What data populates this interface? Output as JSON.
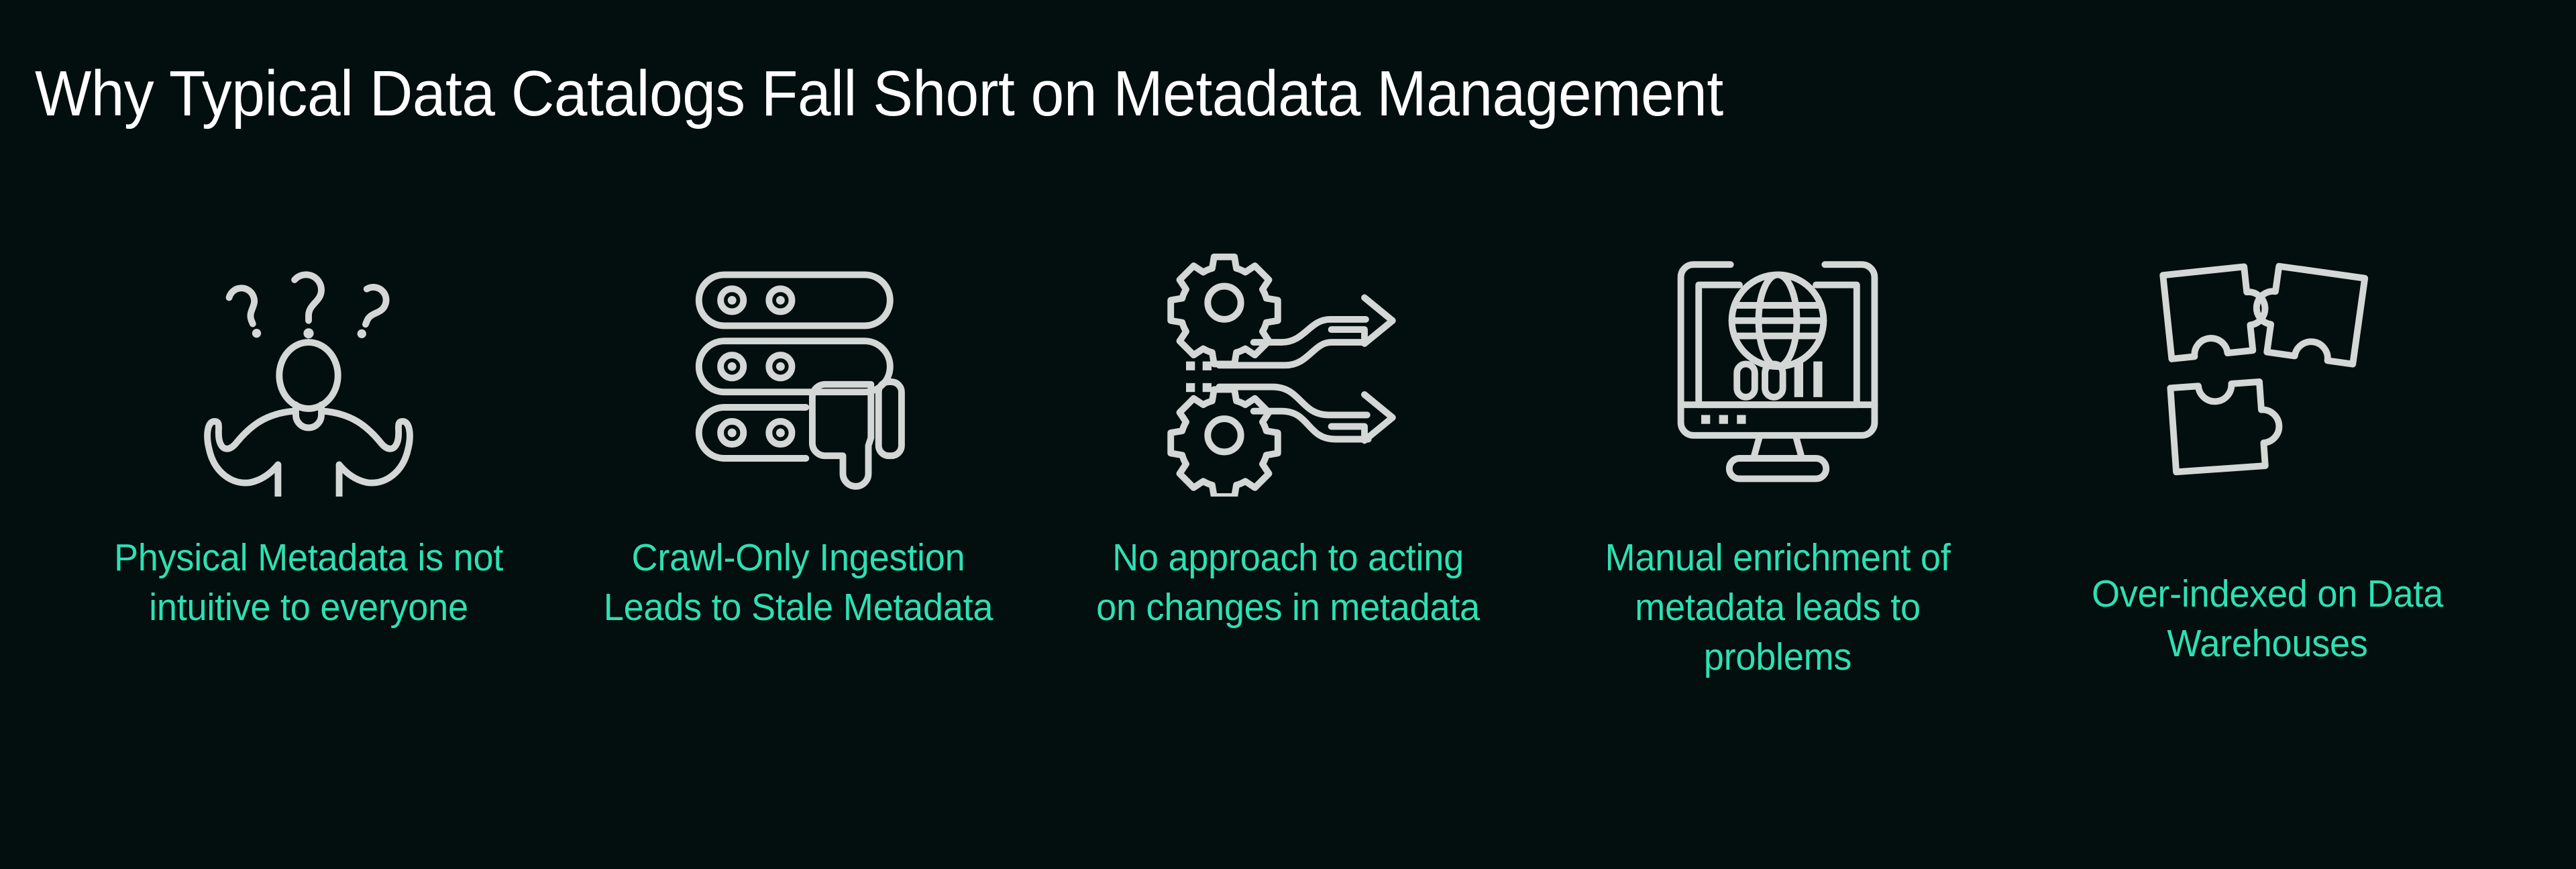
{
  "slide": {
    "title": "Why Typical Data Catalogs Fall Short on Metadata Management",
    "background_color": "#030e0e",
    "title_color": "#ffffff",
    "caption_color": "#2ee0b3",
    "icon_color": "#d3d7d5"
  },
  "columns": [
    {
      "icon": "confused-person-question-marks-icon",
      "caption": "Physical Metadata is not intuitive to everyone"
    },
    {
      "icon": "server-stack-thumbs-down-icon",
      "caption": "Crawl-Only Ingestion Leads to Stale Metadata"
    },
    {
      "icon": "gears-crossing-arrows-icon",
      "caption": "No approach to acting on changes in metadata"
    },
    {
      "icon": "monitor-globe-binary-icon",
      "caption": "Manual enrichment of metadata leads to problems"
    },
    {
      "icon": "puzzle-pieces-icon",
      "caption": "Over-indexed on Data Warehouses"
    }
  ]
}
